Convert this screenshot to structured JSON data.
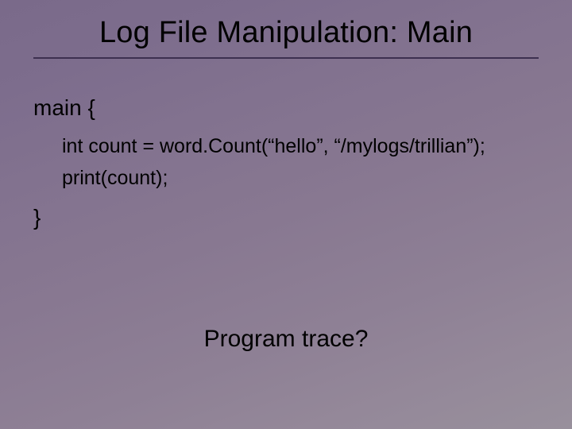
{
  "slide": {
    "title": "Log File Manipulation: Main",
    "main_open": "main {",
    "code_line_1": "int count = word.Count(“hello”, “/mylogs/trillian”);",
    "code_line_2": "print(count);",
    "main_close": "}",
    "question": "Program trace?"
  }
}
